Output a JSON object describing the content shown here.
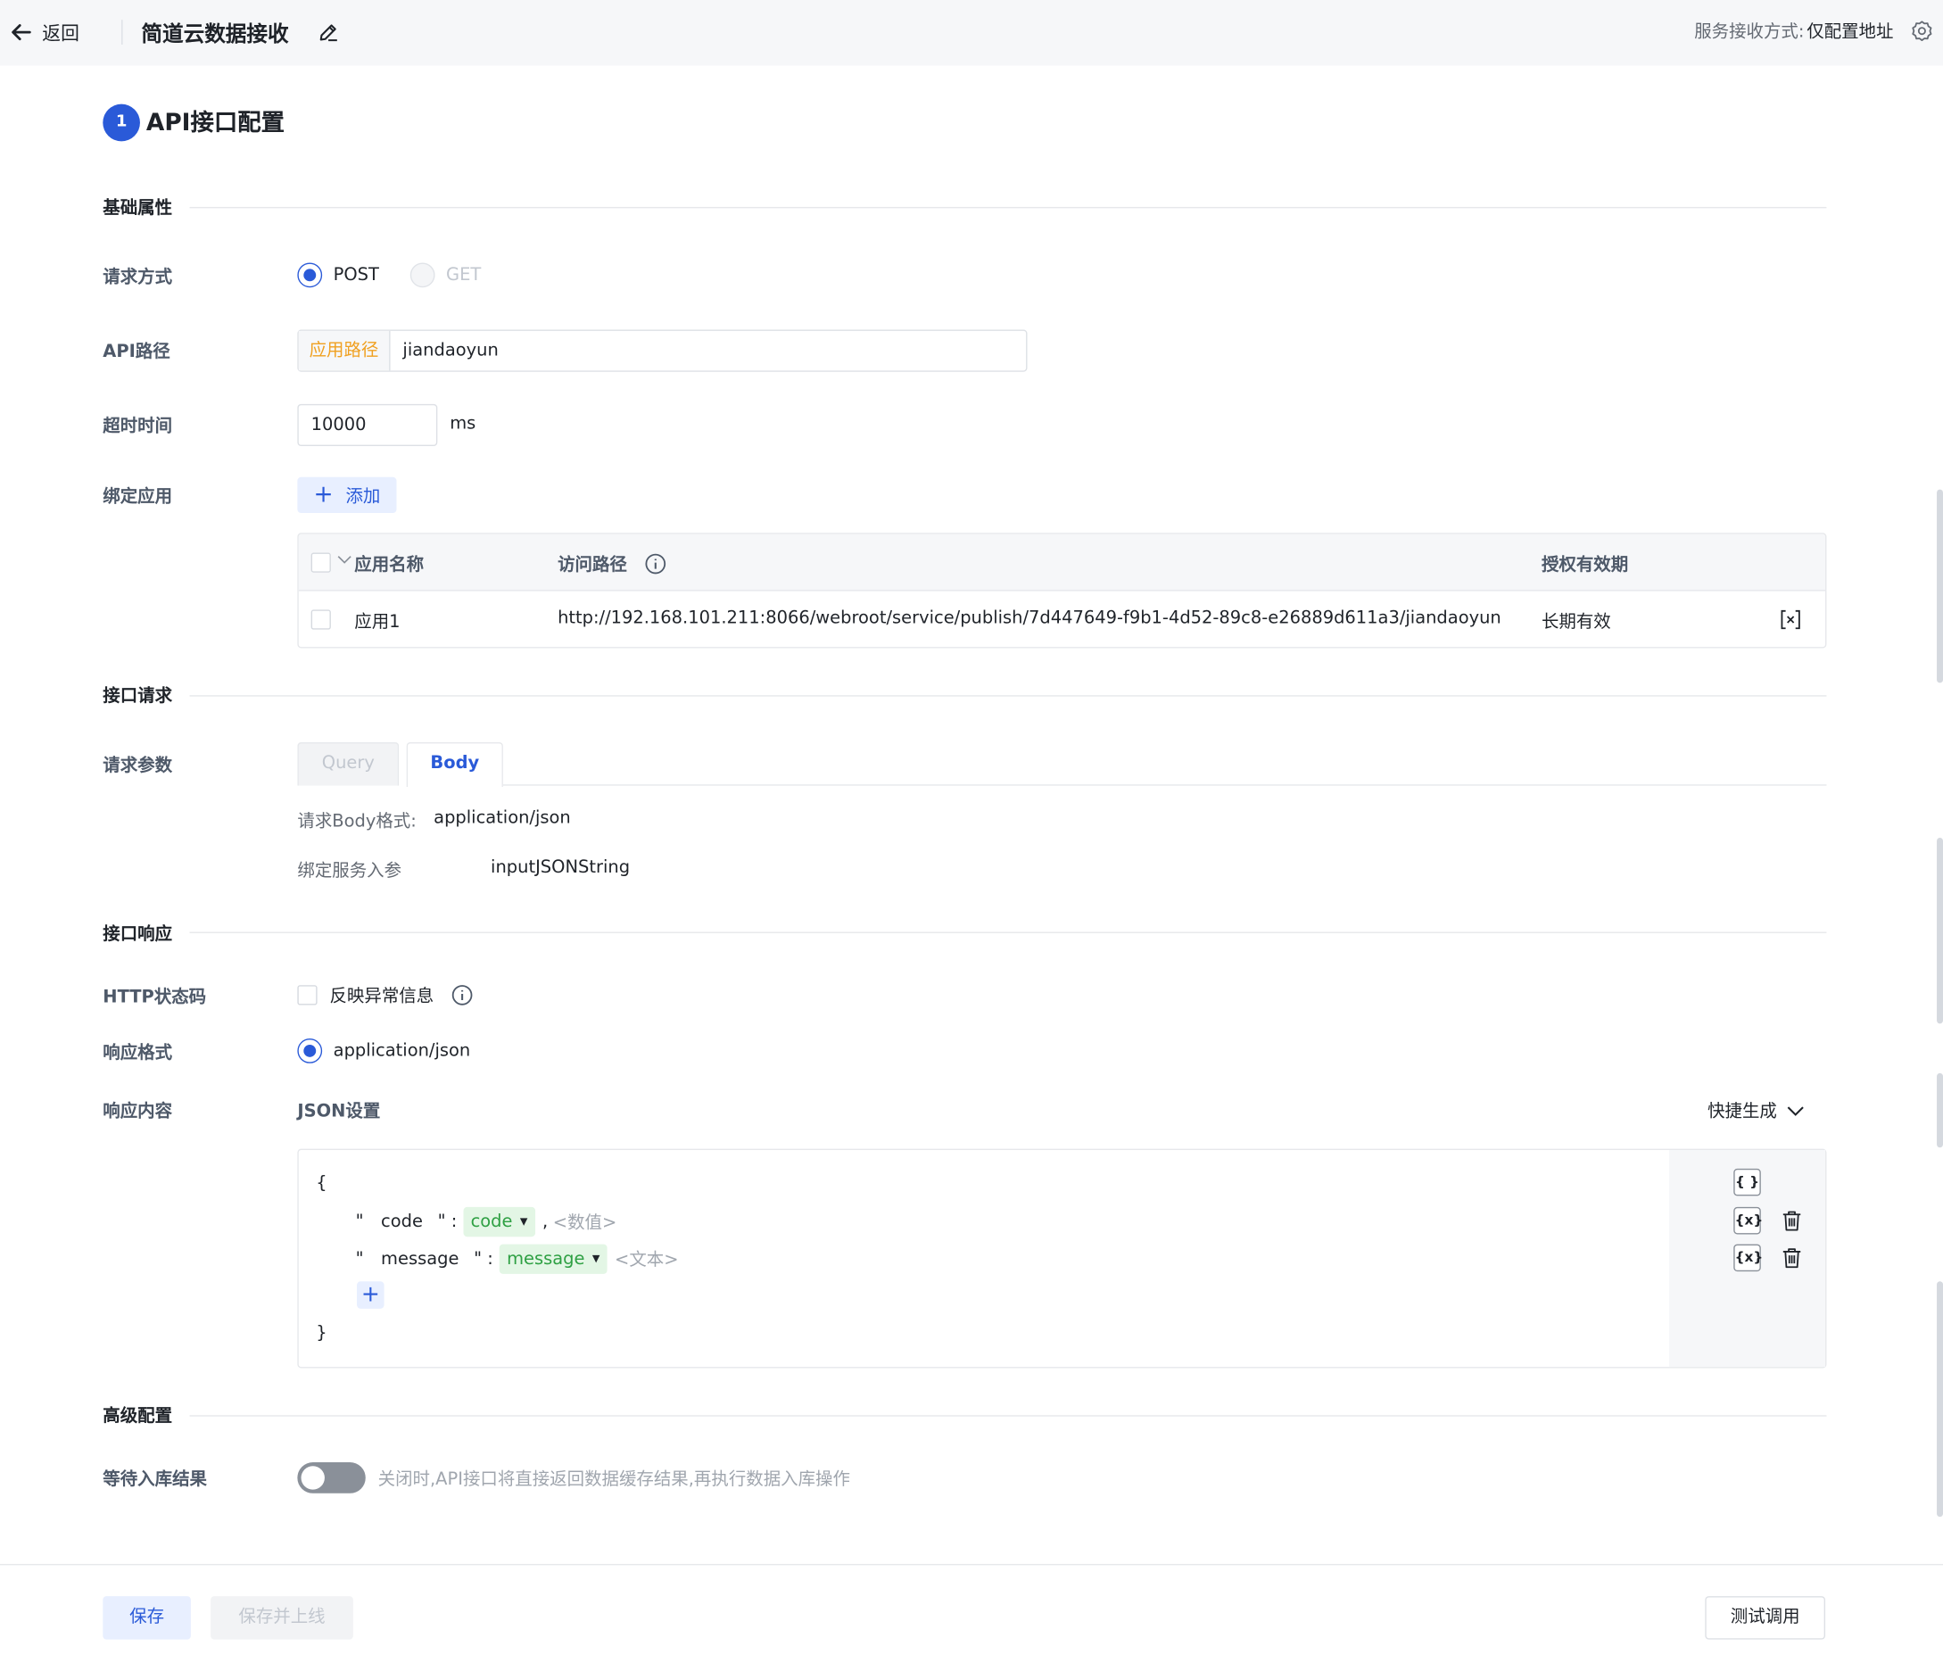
{
  "header": {
    "back_label": "返回",
    "title": "简道云数据接收",
    "service_mode_label": "服务接收方式:",
    "service_mode_value": "仅配置地址"
  },
  "step": {
    "number": "1",
    "title": "API接口配置"
  },
  "sections": {
    "basic": "基础属性",
    "request": "接口请求",
    "response": "接口响应",
    "advanced": "高级配置"
  },
  "basic": {
    "method_label": "请求方式",
    "method_options": [
      "POST",
      "GET"
    ],
    "method_selected": "POST",
    "api_path_label": "API路径",
    "api_path_prefix": "应用路径",
    "api_path_value": "jiandaoyun",
    "timeout_label": "超时时间",
    "timeout_value": "10000",
    "timeout_unit": "ms",
    "bind_app_label": "绑定应用",
    "add_button": "添加",
    "table": {
      "columns": [
        "应用名称",
        "访问路径",
        "授权有效期"
      ],
      "rows": [
        {
          "name": "应用1",
          "path": "http://192.168.101.211:8066/webroot/service/publish/7d447649-f9b1-4d52-89c8-e26889d611a3/jiandaoyun",
          "validity": "长期有效"
        }
      ]
    }
  },
  "request": {
    "params_label": "请求参数",
    "tabs": [
      "Query",
      "Body"
    ],
    "active_tab": "Body",
    "body_format_label": "请求Body格式:",
    "body_format_value": "application/json",
    "bind_param_label": "绑定服务入参",
    "bind_param_value": "inputJSONString"
  },
  "response": {
    "http_status_label": "HTTP状态码",
    "reflect_error_label": "反映异常信息",
    "format_label": "响应格式",
    "format_value": "application/json",
    "content_label": "响应内容",
    "json_settings_label": "JSON设置",
    "quick_generate": "快捷生成",
    "json": {
      "open_brace": "{",
      "close_brace": "}",
      "fields": [
        {
          "key": "code",
          "binding": "code",
          "hint": "<数值>"
        },
        {
          "key": "message",
          "binding": "message",
          "hint": "<文本>"
        }
      ],
      "side_object_btn": "{ }",
      "side_var_btn": "{x}"
    }
  },
  "advanced": {
    "wait_label": "等待入库结果",
    "wait_enabled": false,
    "wait_desc": "关闭时,API接口将直接返回数据缓存结果,再执行数据入库操作"
  },
  "footer": {
    "save": "保存",
    "save_publish": "保存并上线",
    "test_call": "测试调用"
  },
  "colors": {
    "accent": "#2a5ad8",
    "prefix_orange": "#f0a020",
    "tag_green": "#2ea043"
  }
}
